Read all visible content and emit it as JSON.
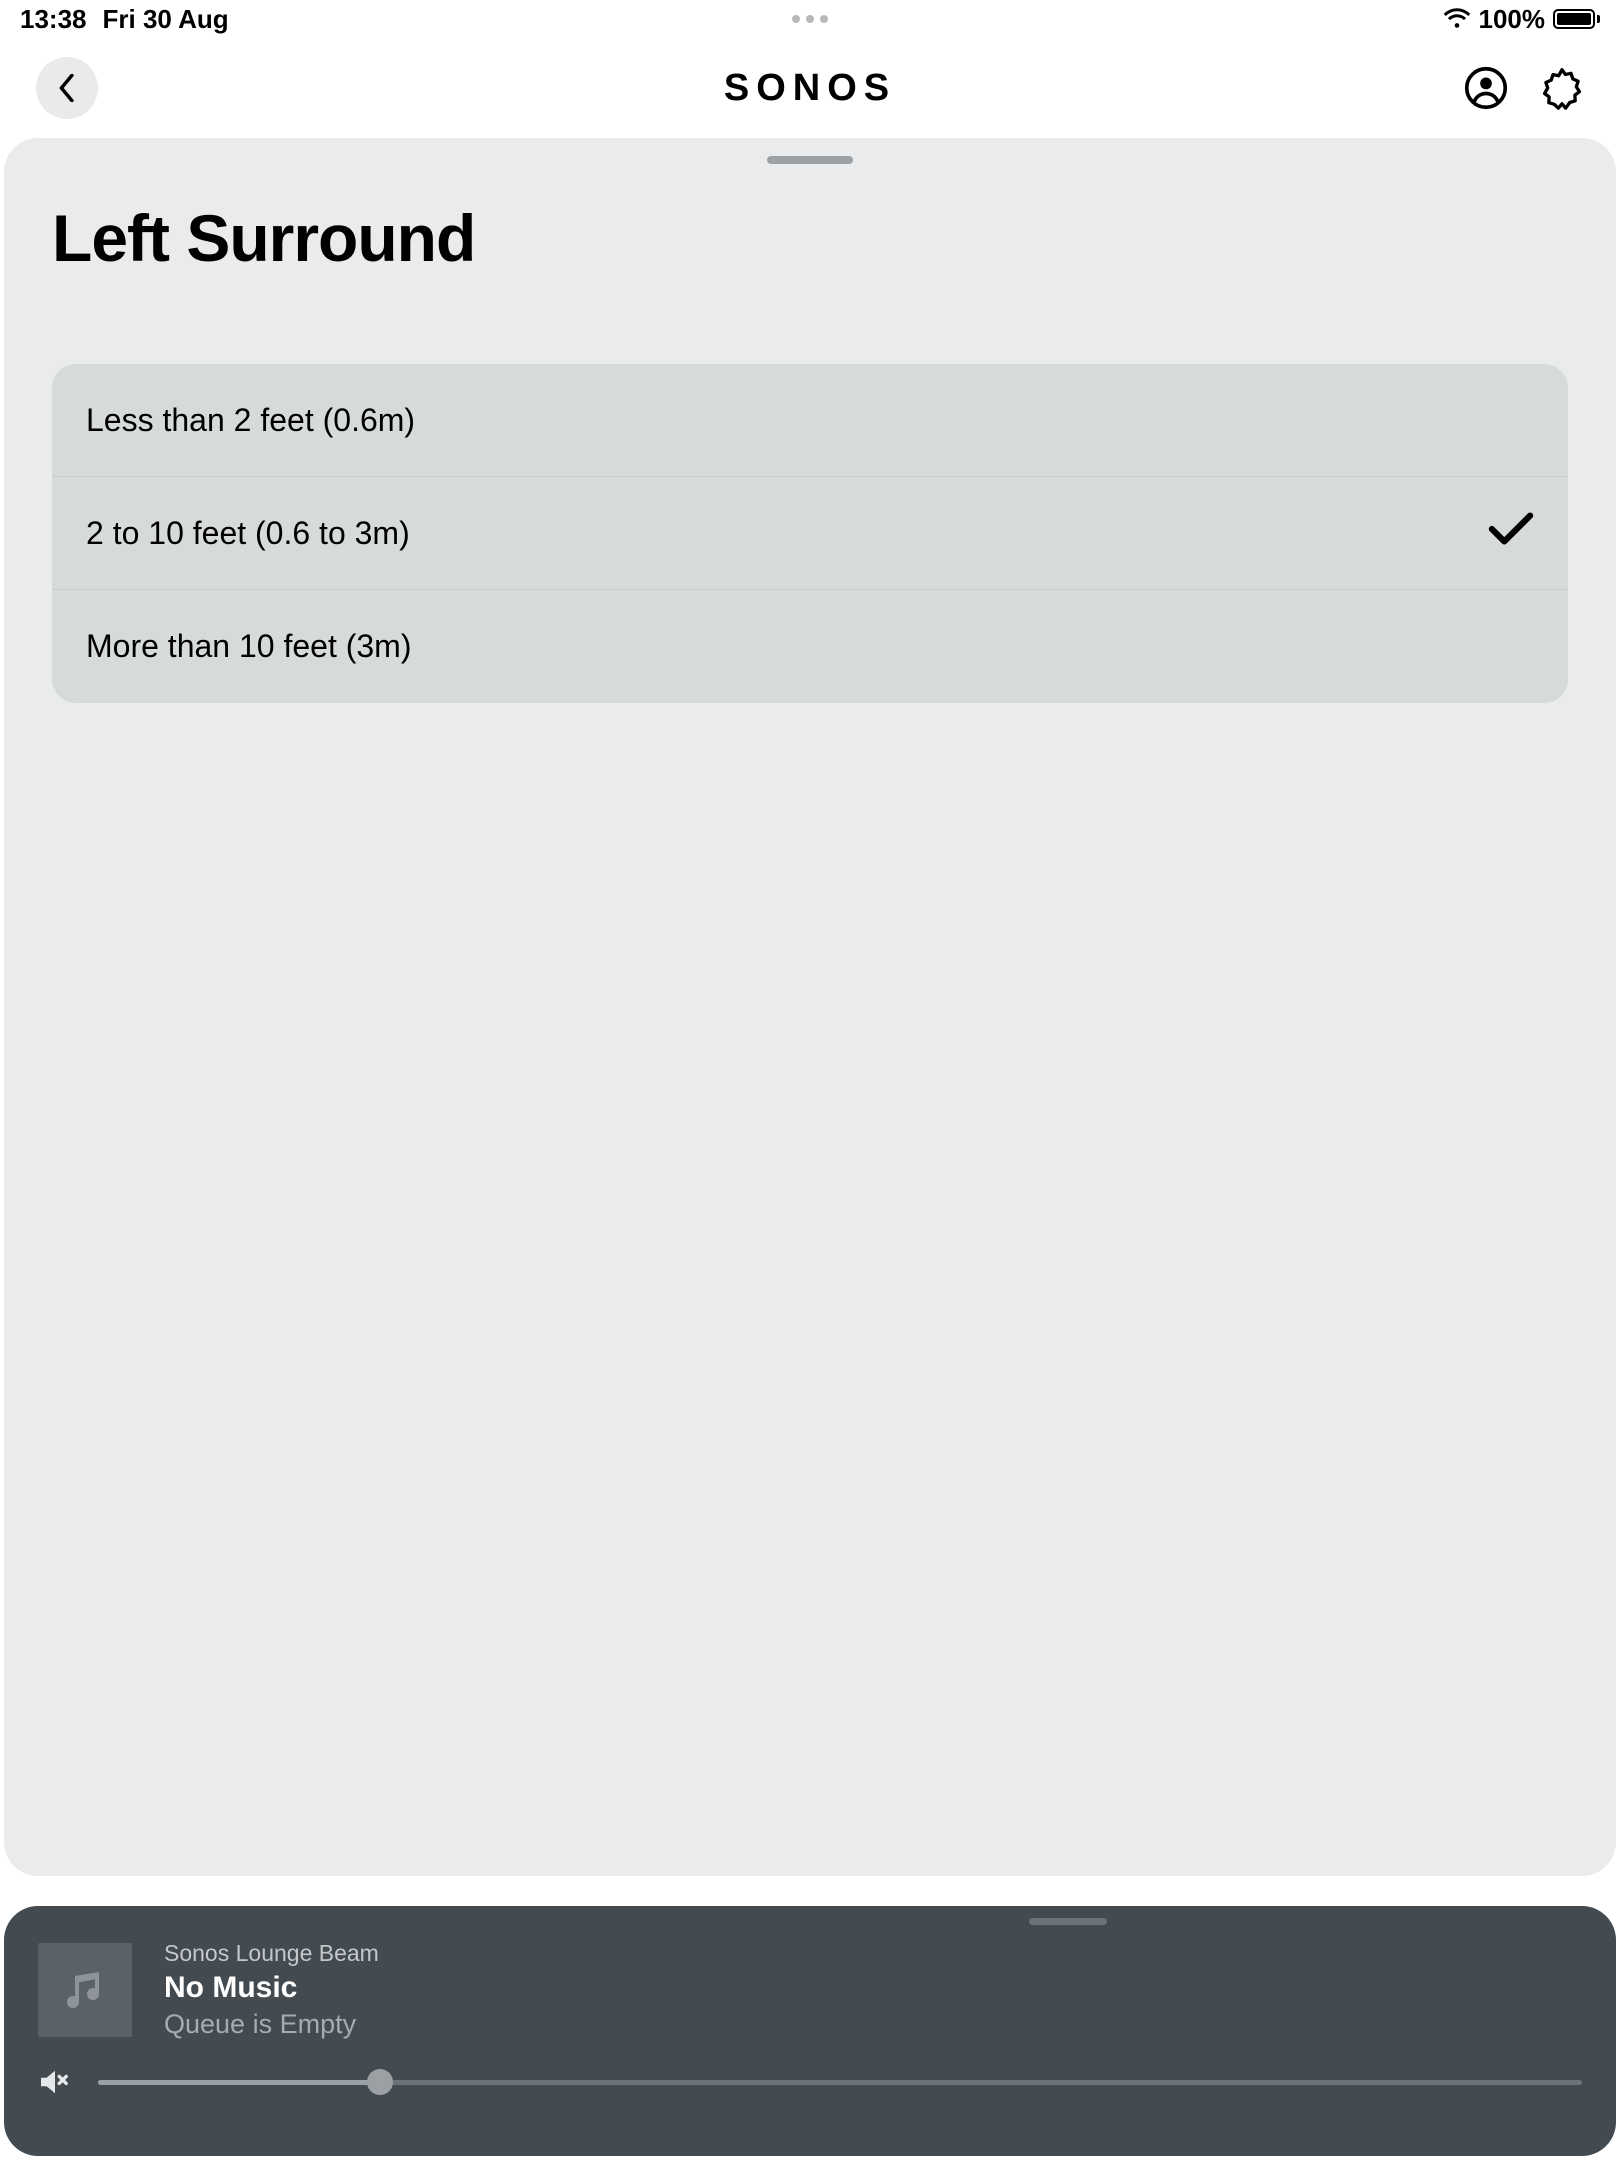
{
  "status": {
    "time": "13:38",
    "date": "Fri 30 Aug",
    "battery_pct": "100%"
  },
  "brand": "SONOS",
  "page": {
    "title": "Left Surround",
    "options": [
      {
        "label": "Less than 2 feet (0.6m)",
        "selected": false
      },
      {
        "label": "2 to 10 feet (0.6 to 3m)",
        "selected": true
      },
      {
        "label": "More than 10 feet (3m)",
        "selected": false
      }
    ]
  },
  "player": {
    "room": "Sonos Lounge Beam",
    "title": "No Music",
    "subtitle": "Queue is Empty",
    "volume_pct": 19
  }
}
